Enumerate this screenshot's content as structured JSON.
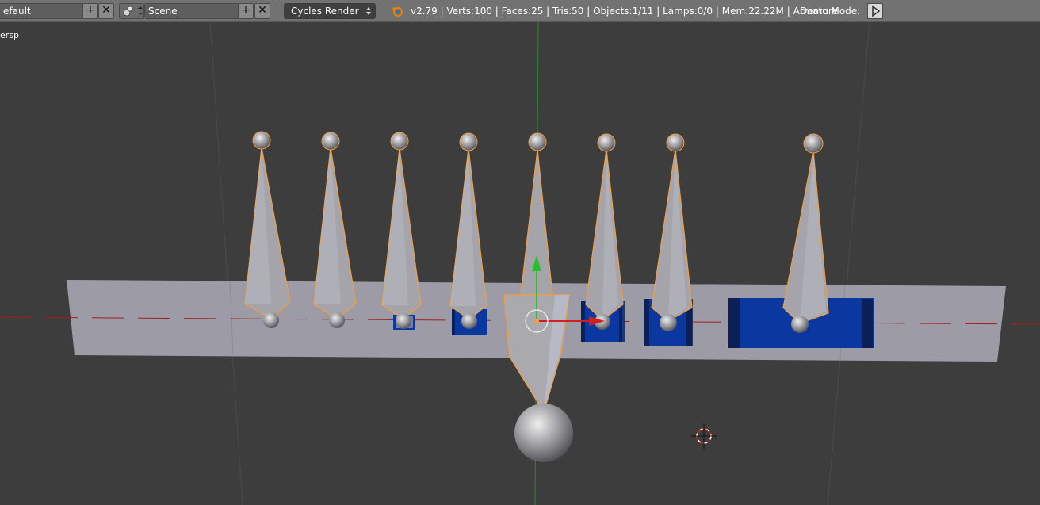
{
  "header": {
    "screen_layout": "efault",
    "scene_name": "Scene",
    "render_engine": "Cycles Render",
    "stats": "v2.79 | Verts:100 | Faces:25 | Tris:50 | Objects:1/11 | Lamps:0/0 | Mem:22.22M | Armature",
    "demo_mode_label": "Demo Mode:",
    "add_icon": "plus-icon",
    "remove_icon": "x-icon",
    "play_icon": "play-icon"
  },
  "viewport": {
    "view_label": "ersp"
  },
  "colors": {
    "header_bg": "#727272",
    "viewport_bg": "#3d3d3d",
    "plane": "#9d9ba6",
    "bone": "#9e9ea4",
    "bone_outline": "#f0a040",
    "blue_mesh": "#0a37a0",
    "dark_blue": "#0c2058",
    "x_axis": "#a02020",
    "y_axis": "#2a8a2a"
  }
}
